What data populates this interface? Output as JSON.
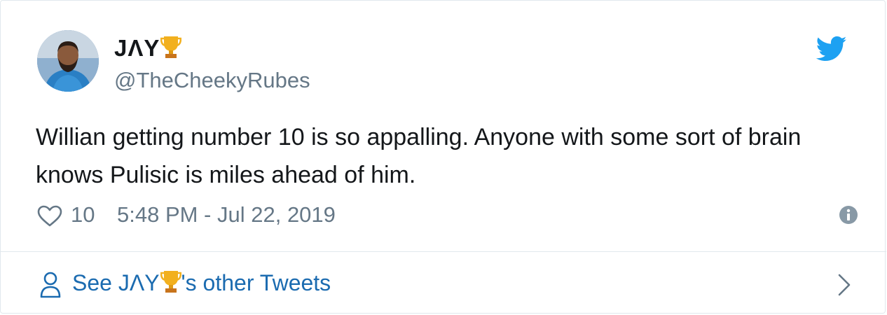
{
  "author": {
    "display_name": "JΛY",
    "display_emoji": "trophy-emoji",
    "handle": "@TheCheekyRubes",
    "avatar": "profile-photo"
  },
  "tweet": {
    "text": "Willian getting number 10 is so appalling. Anyone with some sort of brain knows Pulisic is miles ahead of him.",
    "like_count": "10",
    "timestamp": "5:48 PM - Jul 22, 2019"
  },
  "footer": {
    "prefix": "See JΛY",
    "suffix": "'s other Tweets"
  },
  "icons": {
    "brand": "twitter-bird-icon",
    "like": "heart-icon",
    "info": "info-icon",
    "person": "person-icon",
    "chevron": "chevron-right-icon"
  },
  "colors": {
    "brand": "#1da1f2",
    "text": "#14171a",
    "secondary": "#657786",
    "link": "#1b6bb0",
    "border": "#e1e8ed"
  }
}
